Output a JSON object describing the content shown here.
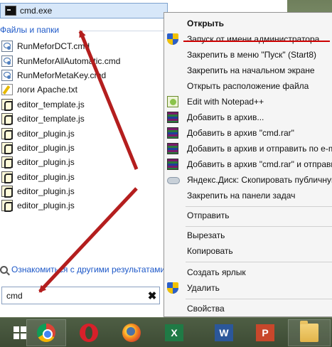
{
  "start_menu": {
    "top_result": {
      "label": "cmd.exe",
      "icon": "command-prompt-icon"
    },
    "section_title": "Файлы и папки",
    "files": [
      {
        "name": "RunMeforDCT.cmd",
        "icon": "cmd-script-icon"
      },
      {
        "name": "RunMeforAllAutomatic.cmd",
        "icon": "cmd-script-icon"
      },
      {
        "name": "RunMeforMetaKey.cmd",
        "icon": "cmd-script-icon"
      },
      {
        "name": "логи Apache.txt",
        "icon": "text-file-icon"
      },
      {
        "name": "editor_template.js",
        "icon": "js-file-icon"
      },
      {
        "name": "editor_template.js",
        "icon": "js-file-icon"
      },
      {
        "name": "editor_plugin.js",
        "icon": "js-file-icon"
      },
      {
        "name": "editor_plugin.js",
        "icon": "js-file-icon"
      },
      {
        "name": "editor_plugin.js",
        "icon": "js-file-icon"
      },
      {
        "name": "editor_plugin.js",
        "icon": "js-file-icon"
      },
      {
        "name": "editor_plugin.js",
        "icon": "js-file-icon"
      },
      {
        "name": "editor_plugin.js",
        "icon": "js-file-icon"
      }
    ],
    "more_results": "Ознакомиться с другими результатами",
    "search": {
      "value": "cmd",
      "clear_glyph": "✖"
    }
  },
  "context_menu": {
    "items": [
      {
        "label": "Открыть",
        "bold": true,
        "icon": ""
      },
      {
        "label": "Запуск от имени администратора",
        "icon": "uac-shield-icon",
        "highlight": true
      },
      {
        "label": "Закрепить в меню \"Пуск\" (Start8)",
        "icon": ""
      },
      {
        "label": "Закрепить на начальном экране",
        "icon": ""
      },
      {
        "label": "Открыть расположение файла",
        "icon": ""
      },
      {
        "label": "Edit with Notepad++",
        "icon": "notepad-plus-plus-icon"
      },
      {
        "label": "Добавить в архив...",
        "icon": "winrar-icon"
      },
      {
        "label": "Добавить в архив \"cmd.rar\"",
        "icon": "winrar-icon"
      },
      {
        "label": "Добавить в архив и отправить по e-mail...",
        "icon": "winrar-icon"
      },
      {
        "label": "Добавить в архив \"cmd.rar\" и отправить по e-mail",
        "icon": "winrar-icon"
      },
      {
        "label": "Яндекс.Диск: Скопировать публичную ссылку",
        "icon": "yandex-disk-icon"
      },
      {
        "label": "Закрепить на панели задач",
        "icon": ""
      },
      {
        "label": "Отправить",
        "icon": ""
      },
      {
        "label": "Вырезать",
        "icon": ""
      },
      {
        "label": "Копировать",
        "icon": ""
      },
      {
        "label": "Создать ярлык",
        "icon": ""
      },
      {
        "label": "Удалить",
        "icon": "uac-shield-icon"
      },
      {
        "label": "Свойства",
        "icon": ""
      }
    ]
  },
  "taskbar": {
    "items": [
      {
        "name": "start-button",
        "icon": "windows-logo-icon"
      },
      {
        "name": "chrome",
        "icon": "chrome-icon"
      },
      {
        "name": "opera",
        "icon": "opera-icon"
      },
      {
        "name": "firefox",
        "icon": "firefox-icon"
      },
      {
        "name": "excel",
        "icon": "excel-icon",
        "letter": "X"
      },
      {
        "name": "word",
        "icon": "word-icon",
        "letter": "W"
      },
      {
        "name": "powerpoint",
        "icon": "powerpoint-icon",
        "letter": "P"
      },
      {
        "name": "explorer",
        "icon": "folder-icon"
      }
    ]
  },
  "colors": {
    "accent_link": "#1d58c8",
    "highlight_bg": "#d7e7f9",
    "annotation_red": "#b41e1e",
    "taskbar_bg": "#3d4b34"
  }
}
